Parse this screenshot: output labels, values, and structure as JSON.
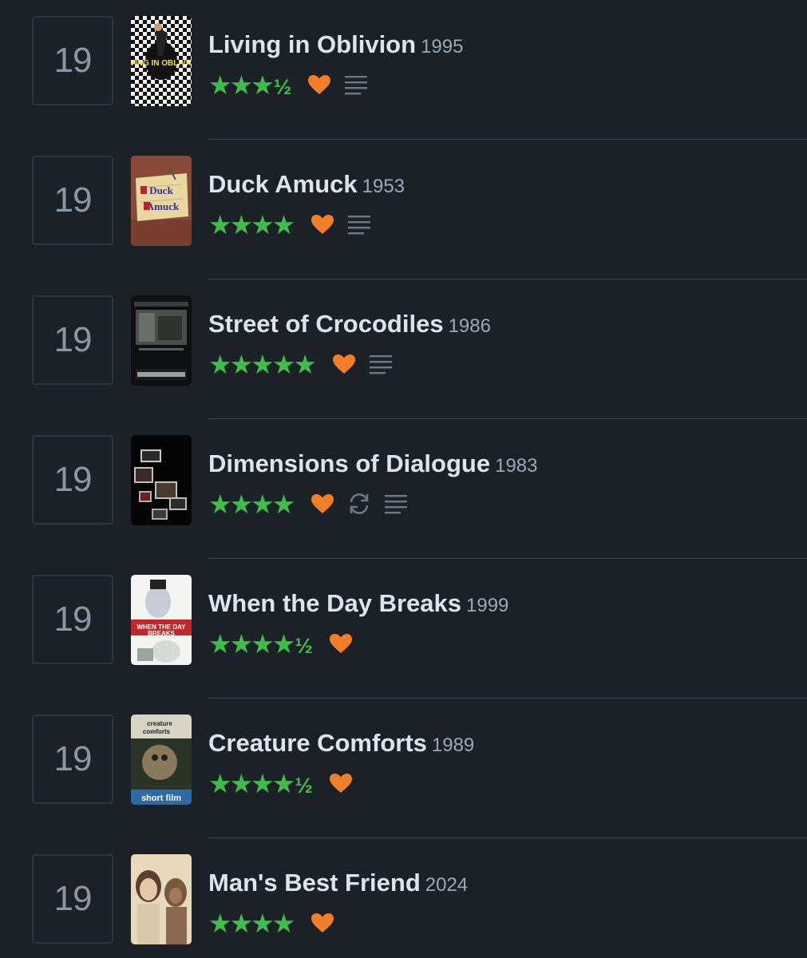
{
  "diary": {
    "entries": [
      {
        "day": "19",
        "title": "Living in Oblivion",
        "year": "1995",
        "stars": "★★★",
        "half": "½",
        "liked": true,
        "rewatch": false,
        "review": true
      },
      {
        "day": "19",
        "title": "Duck Amuck",
        "year": "1953",
        "stars": "★★★★",
        "half": "",
        "liked": true,
        "rewatch": false,
        "review": true
      },
      {
        "day": "19",
        "title": "Street of Crocodiles",
        "year": "1986",
        "stars": "★★★★★",
        "half": "",
        "liked": true,
        "rewatch": false,
        "review": true
      },
      {
        "day": "19",
        "title": "Dimensions of Dialogue",
        "year": "1983",
        "stars": "★★★★",
        "half": "",
        "liked": true,
        "rewatch": true,
        "review": true
      },
      {
        "day": "19",
        "title": "When the Day Breaks",
        "year": "1999",
        "stars": "★★★★",
        "half": "½",
        "liked": true,
        "rewatch": false,
        "review": false
      },
      {
        "day": "19",
        "title": "Creature Comforts",
        "year": "1989",
        "stars": "★★★★",
        "half": "½",
        "liked": true,
        "rewatch": false,
        "review": false
      },
      {
        "day": "19",
        "title": "Man's Best Friend",
        "year": "2024",
        "stars": "★★★★",
        "half": "",
        "liked": true,
        "rewatch": false,
        "review": false
      }
    ]
  },
  "posters": [
    {
      "icon": "poster-living-in-oblivion",
      "text": "LIVING IN OBLIVION"
    },
    {
      "icon": "poster-duck-amuck",
      "text": "Duck Amuck"
    },
    {
      "icon": "poster-street-of-crocodiles",
      "text": ""
    },
    {
      "icon": "poster-dimensions-of-dialogue",
      "text": ""
    },
    {
      "icon": "poster-when-the-day-breaks",
      "text": "WHEN THE DAY BREAKS"
    },
    {
      "icon": "poster-creature-comforts",
      "text": "short film"
    },
    {
      "icon": "poster-mans-best-friend",
      "text": ""
    }
  ],
  "colors": {
    "background": "#1c2127",
    "star": "#40bc4d",
    "heart": "#f27f27",
    "icon_muted": "#6b7885",
    "title": "#dce4ec",
    "year": "#99a9b8"
  },
  "icons": {
    "like": "heart-icon",
    "rewatch": "rewatch-icon",
    "review": "review-lines-icon"
  }
}
